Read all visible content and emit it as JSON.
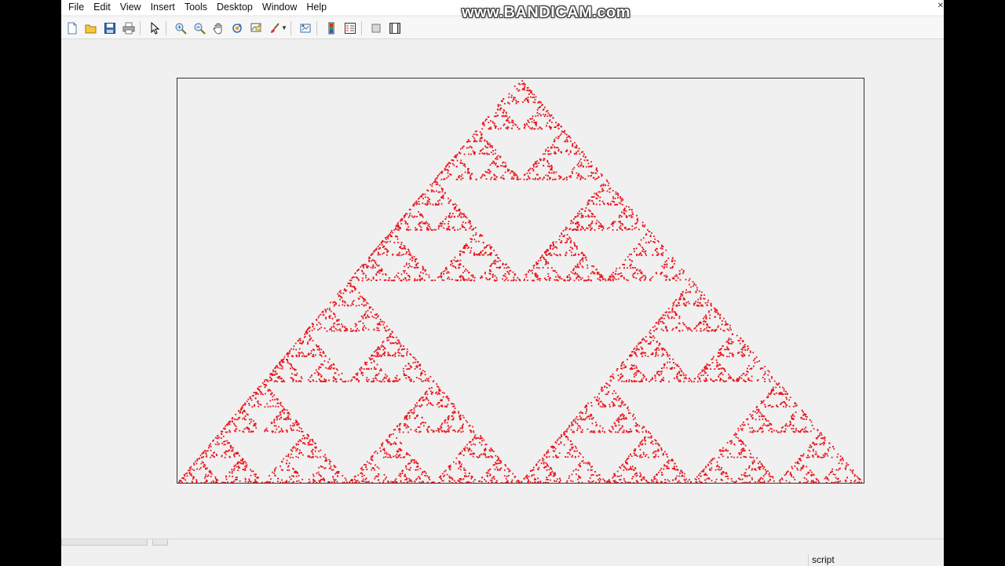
{
  "menubar": {
    "items": [
      "File",
      "Edit",
      "View",
      "Insert",
      "Tools",
      "Desktop",
      "Window",
      "Help"
    ]
  },
  "watermark": "www.BANDICAM.com",
  "toolbar": {
    "icons": [
      "new-figure-icon",
      "open-file-icon",
      "save-icon",
      "print-icon",
      "pointer-icon",
      "zoom-in-icon",
      "zoom-out-icon",
      "pan-icon",
      "rotate-3d-icon",
      "data-cursor-icon",
      "brush-icon",
      "link-plot-icon",
      "colorbar-icon",
      "legend-icon",
      "hide-plot-tools-icon",
      "show-plot-tools-icon"
    ]
  },
  "figure": {
    "marker_color": "#e8141c",
    "background": "#f0f0f0"
  },
  "chart_data": {
    "type": "scatter",
    "description_kind": "sierpinski-chaos-game",
    "vertices": [
      [
        0,
        0
      ],
      [
        1,
        0
      ],
      [
        0.5,
        1
      ]
    ],
    "xlim": [
      0,
      1
    ],
    "ylim": [
      0,
      1
    ],
    "points": 7000,
    "grid": false,
    "axis_ticks": false
  },
  "status": {
    "label": "script"
  }
}
